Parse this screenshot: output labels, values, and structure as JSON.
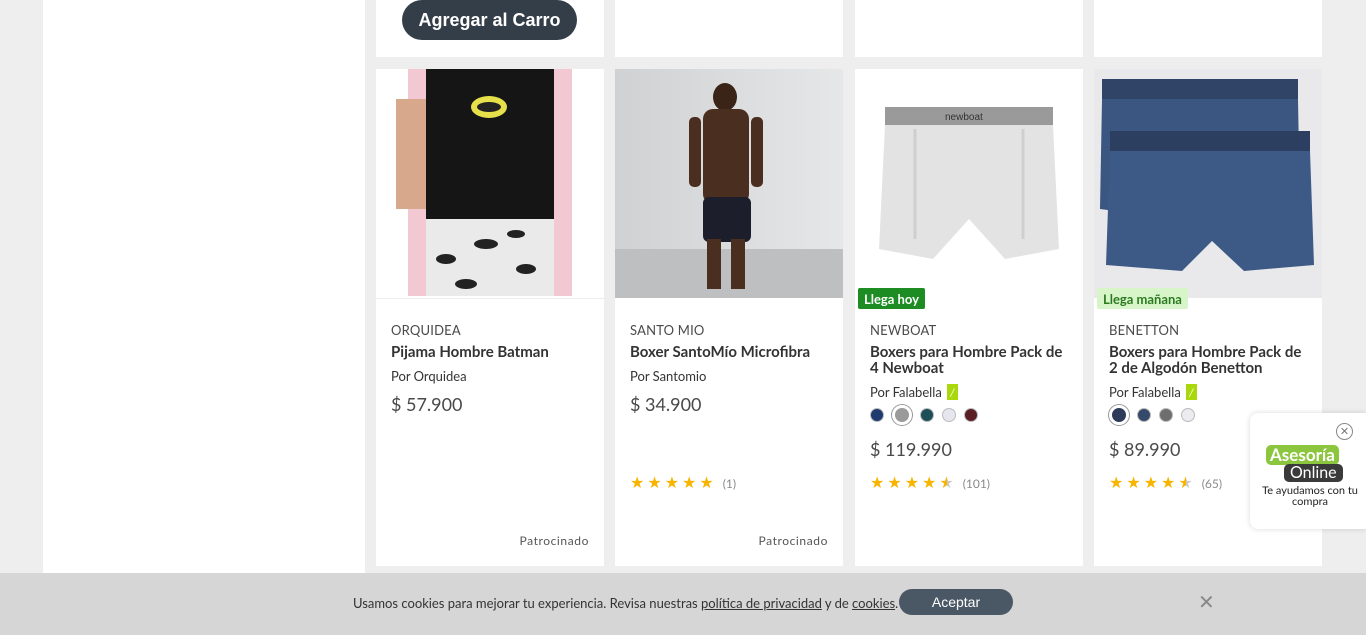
{
  "top_row": {
    "add_to_cart_label": "Agregar al Carro"
  },
  "products": [
    {
      "brand": "ORQUIDEA",
      "title": "Pijama Hombre Batman",
      "seller": "Por Orquidea",
      "price": "$ 57.900",
      "sponsored": "Patrocinado"
    },
    {
      "brand": "SANTO MIO",
      "title": "Boxer SantoMío Microfibra",
      "seller": "Por Santomio",
      "price": "$ 34.900",
      "rating": 5,
      "reviews": "(1)",
      "sponsored": "Patrocinado"
    },
    {
      "brand": "NEWBOAT",
      "title": "Boxers para Hombre Pack de 4 Newboat",
      "seller": "Por Falabella",
      "price": "$ 119.990",
      "badge": "Llega hoy",
      "rating": 4.5,
      "reviews": "(101)",
      "swatches": [
        "#1f3a6e",
        "#9a9a9a",
        "#1e4f59",
        "#e6e6ee",
        "#5a1e24"
      ]
    },
    {
      "brand": "BENETTON",
      "title": "Boxers para Hombre Pack de 2 de Algodón Benetton",
      "seller": "Por Falabella",
      "price": "$ 89.990",
      "badge": "Llega mañana",
      "rating": 4.5,
      "reviews": "(65)",
      "swatches": [
        "#2d3a5a",
        "#354a6b",
        "#6e6e6e",
        "#ebebf0"
      ]
    }
  ],
  "cookie": {
    "text_before": "Usamos cookies para mejorar tu experiencia. Revisa nuestras ",
    "privacy_link": "política de privacidad",
    "text_middle": " y de ",
    "cookies_link": "cookies",
    "text_end": ".",
    "accept_label": "Aceptar",
    "close_icon": "close-icon"
  },
  "asesoria": {
    "title_top": "Asesoría",
    "title_bottom": "Online",
    "subtitle": "Te ayudamos con tu compra"
  }
}
